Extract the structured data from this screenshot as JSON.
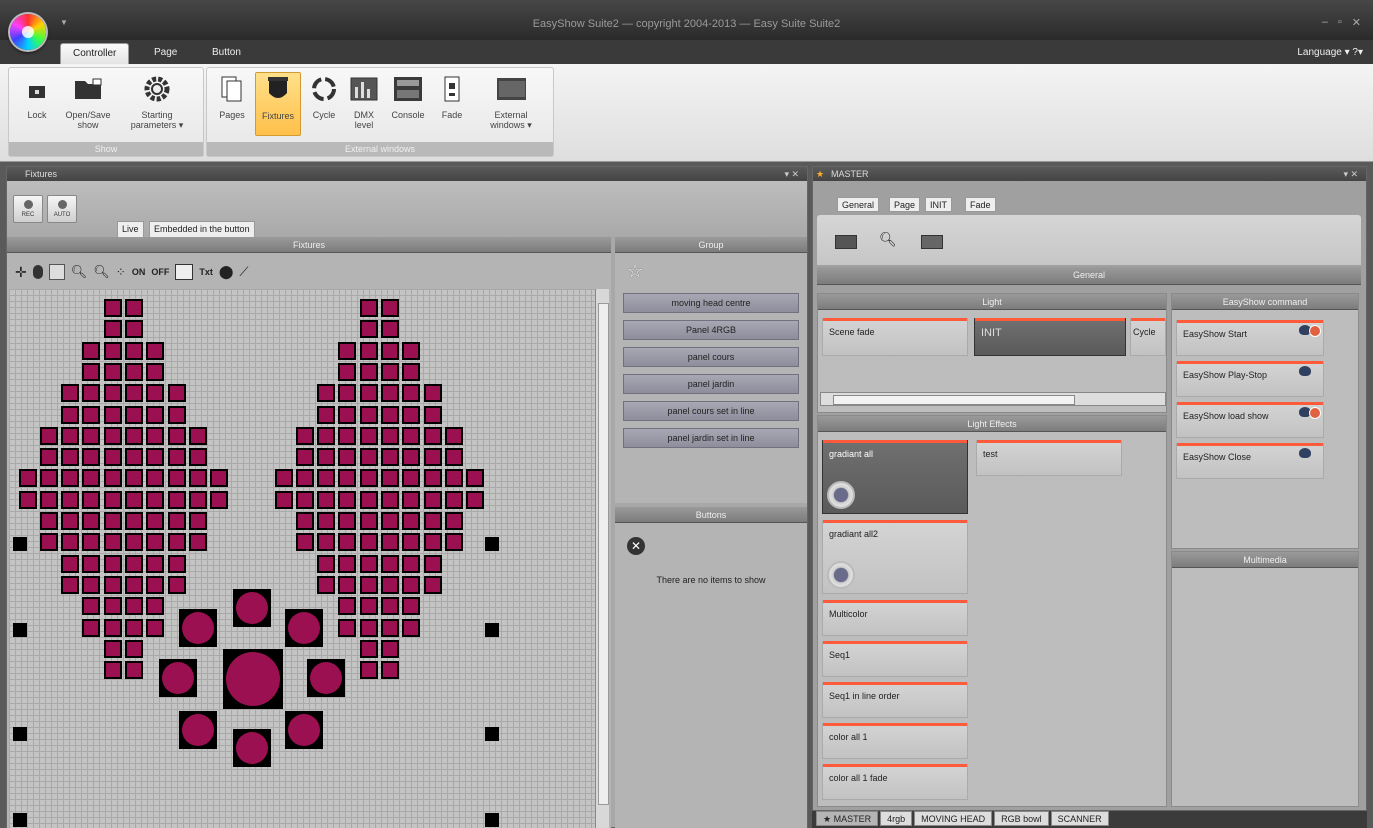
{
  "window": {
    "title": "EasyShow Suite2 — copyright 2004-2013 — Easy Suite Suite2",
    "controls": [
      "–",
      "▫",
      "✕"
    ]
  },
  "ribbon": {
    "tabs": [
      "Controller",
      "Page",
      "Button"
    ],
    "active_tab": "Controller",
    "language_label": "Language ▾ ?▾",
    "groups": [
      {
        "label": "Show",
        "buttons": [
          {
            "label": "Lock",
            "icon": "lock-icon"
          },
          {
            "label": "Open/Save show",
            "icon": "folder-icon"
          },
          {
            "label": "Starting parameters ▾",
            "icon": "gear-icon"
          }
        ]
      },
      {
        "label": "External windows",
        "buttons": [
          {
            "label": "Pages",
            "icon": "pages-icon"
          },
          {
            "label": "Fixtures",
            "icon": "fixtures-icon",
            "active": true
          },
          {
            "label": "Cycle",
            "icon": "cycle-icon"
          },
          {
            "label": "DMX level",
            "icon": "dmx-level-icon"
          },
          {
            "label": "Console",
            "icon": "console-icon"
          },
          {
            "label": "Fade",
            "icon": "fade-icon"
          },
          {
            "label": "External windows ▾",
            "icon": "external-windows-icon"
          }
        ]
      }
    ]
  },
  "fixtures_panel": {
    "title": "Fixtures",
    "controls": "▾ ✕",
    "small_buttons": [
      "REC",
      "AUTO"
    ],
    "tabs": [
      "Live",
      "Embedded in the button"
    ],
    "fixtures_header": "Fixtures",
    "tool_on": "ON",
    "tool_off": "OFF",
    "tool_txt": "Txt",
    "group_header": "Group",
    "groups": [
      "moving head centre",
      "Panel 4RGB",
      "panel cours",
      "panel jardin",
      "panel cours set in line",
      "panel jardin set in line"
    ],
    "buttons_header": "Buttons",
    "no_items": "There are no items to show"
  },
  "master_panel": {
    "title": "MASTER",
    "controls": "▾ ✕",
    "tabs": [
      "General",
      "Page",
      "INIT",
      "Fade"
    ],
    "general_header": "General",
    "light_header": "Light",
    "light_items": [
      "Scene fade",
      "INIT",
      "Cycle"
    ],
    "light_effects_header": "Light Effects",
    "light_effects_col1": [
      "gradiant all",
      "gradiant all2",
      "Multicolor",
      "Seq1",
      "Seq1 in line order",
      "color all 1",
      "color all 1 fade"
    ],
    "light_effects_col2": [
      "test"
    ],
    "easyshow_header": "EasyShow command",
    "easyshow_items": [
      "EasyShow Start",
      "EasyShow Play-Stop",
      "EasyShow load show",
      "EasyShow Close"
    ],
    "multimedia_header": "Multimedia"
  },
  "bottom_tabs": [
    "MASTER",
    "4rgb",
    "MOVING HEAD",
    "RGB bowl",
    "SCANNER"
  ],
  "colors": {
    "fixture": "#9b1050",
    "accent": "#ff5a3a",
    "ribbon_active": "#ffc04a"
  }
}
